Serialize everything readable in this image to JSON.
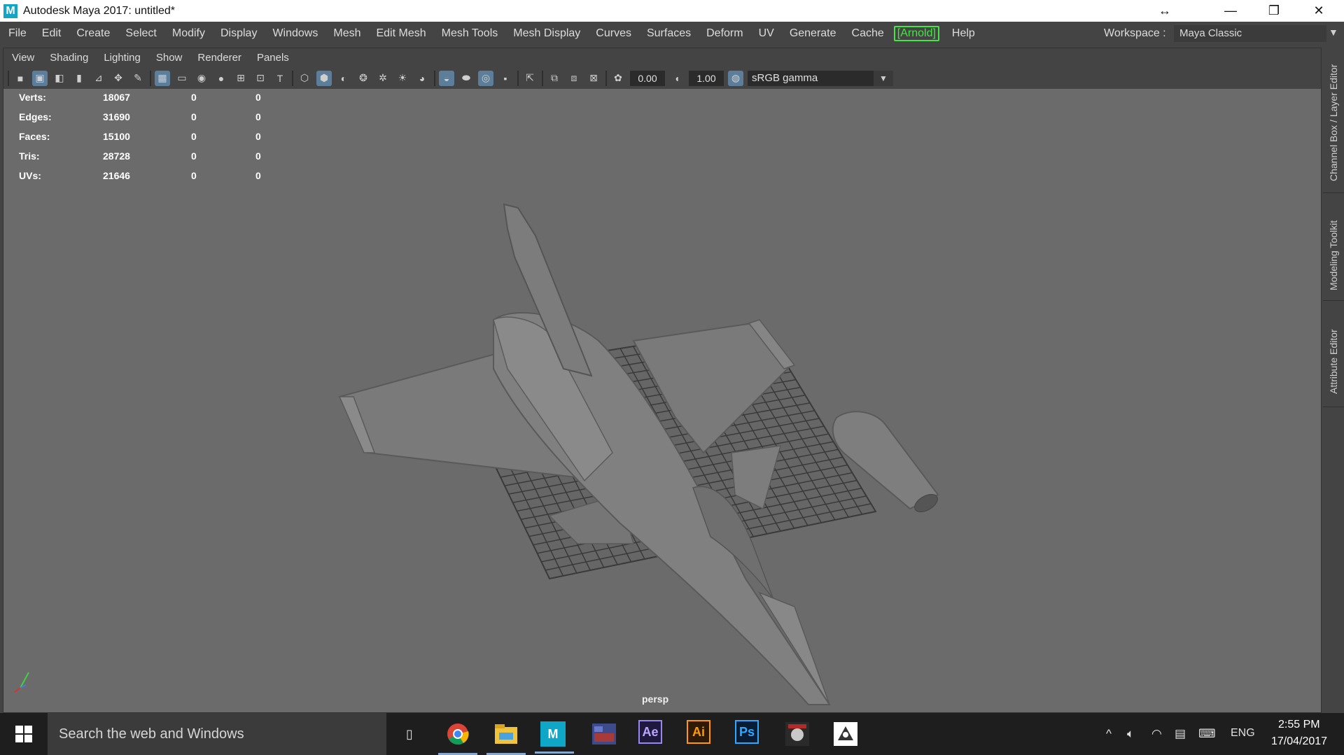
{
  "window": {
    "logo_text": "M",
    "title": "Autodesk Maya 2017: untitled*",
    "controls": {
      "move": "↔",
      "minimize": "—",
      "restore": "❐",
      "close": "✕"
    }
  },
  "menubar": {
    "items": [
      "File",
      "Edit",
      "Create",
      "Select",
      "Modify",
      "Display",
      "Windows",
      "Mesh",
      "Edit Mesh",
      "Mesh Tools",
      "Mesh Display",
      "Curves",
      "Surfaces",
      "Deform",
      "UV",
      "Generate",
      "Cache",
      "[Arnold]",
      "Help"
    ],
    "workspace_label": "Workspace :",
    "workspace_value": "Maya Classic"
  },
  "panel": {
    "menu": [
      "View",
      "Shading",
      "Lighting",
      "Show",
      "Renderer",
      "Panels"
    ],
    "toolbar": {
      "exposure": "0.00",
      "gamma": "1.00",
      "color_space": "sRGB gamma"
    }
  },
  "hud": {
    "rows": [
      {
        "label": "Verts:",
        "v1": "18067",
        "v2": "0",
        "v3": "0"
      },
      {
        "label": "Edges:",
        "v1": "31690",
        "v2": "0",
        "v3": "0"
      },
      {
        "label": "Faces:",
        "v1": "15100",
        "v2": "0",
        "v3": "0"
      },
      {
        "label": "Tris:",
        "v1": "28728",
        "v2": "0",
        "v3": "0"
      },
      {
        "label": "UVs:",
        "v1": "21646",
        "v2": "0",
        "v3": "0"
      }
    ],
    "camera": "persp"
  },
  "sidetabs": [
    "Channel Box / Layer Editor",
    "Modeling Toolkit",
    "Attribute Editor"
  ],
  "taskbar": {
    "search_placeholder": "Search the web and Windows",
    "apps": {
      "after_effects": "Ae",
      "illustrator": "Ai",
      "photoshop": "Ps",
      "maya": "M"
    },
    "language": "ENG",
    "time": "2:55 PM",
    "date": "17/04/2017"
  },
  "colors": {
    "viewport_bg": "#6b6b6b",
    "arnold_accent": "#43e643",
    "taskbar_bg": "#1e1e1e"
  }
}
